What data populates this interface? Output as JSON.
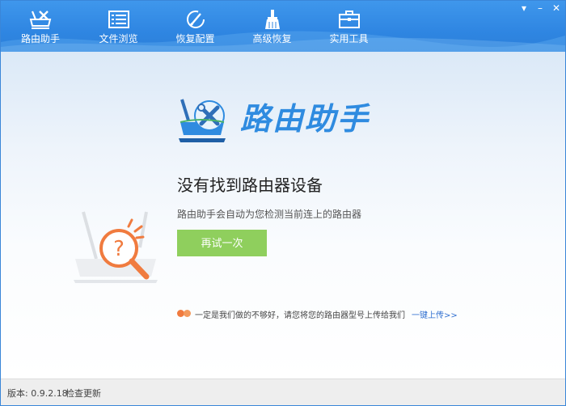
{
  "nav": {
    "items": [
      {
        "label": "路由助手",
        "icon": "router-tools-icon"
      },
      {
        "label": "文件浏览",
        "icon": "file-list-icon"
      },
      {
        "label": "恢复配置",
        "icon": "restore-config-icon"
      },
      {
        "label": "高级恢复",
        "icon": "broom-icon"
      },
      {
        "label": "实用工具",
        "icon": "toolbox-icon"
      }
    ]
  },
  "window_controls": {
    "menu": "▾",
    "minimize": "–",
    "close": "✕"
  },
  "logo": {
    "text": "路由助手"
  },
  "main": {
    "title": "没有找到路由器设备",
    "description": "路由助手会自动为您检测当前连上的路由器",
    "retry_label": "再试一次",
    "feedback_text": "一定是我们做的不够好，请您将您的路由器型号上传给我们",
    "feedback_link": "一键上传>>"
  },
  "status": {
    "version": "版本: 0.9.2.18",
    "check_update": "检查更新"
  },
  "colors": {
    "accent": "#2f86e2",
    "logo_blue": "#2f8be0",
    "retry_green": "#8fcf5d",
    "magnifier_orange": "#f07b3f",
    "link_blue": "#2f6fd0"
  }
}
